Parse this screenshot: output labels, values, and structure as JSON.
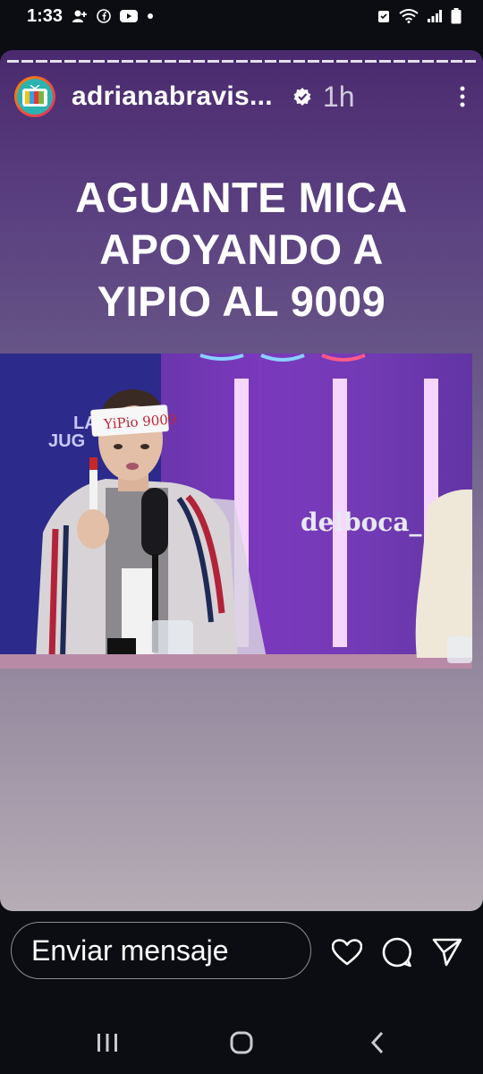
{
  "status_bar": {
    "time": "1:33"
  },
  "story": {
    "username": "adrianabravis...",
    "time_ago": "1h",
    "caption_lines": [
      "AGUANTE MICA",
      "APOYANDO A",
      "YIPIO AL 9009"
    ],
    "video": {
      "watermark": "delboca_",
      "sign_text": "YiPio 9009",
      "backdrop_text_1": "LA",
      "backdrop_text_2": "JUG"
    }
  },
  "message_bar": {
    "placeholder": "Enviar mensaje"
  },
  "colors": {
    "accent": "#5a3f80",
    "background": "#0b0d12"
  }
}
